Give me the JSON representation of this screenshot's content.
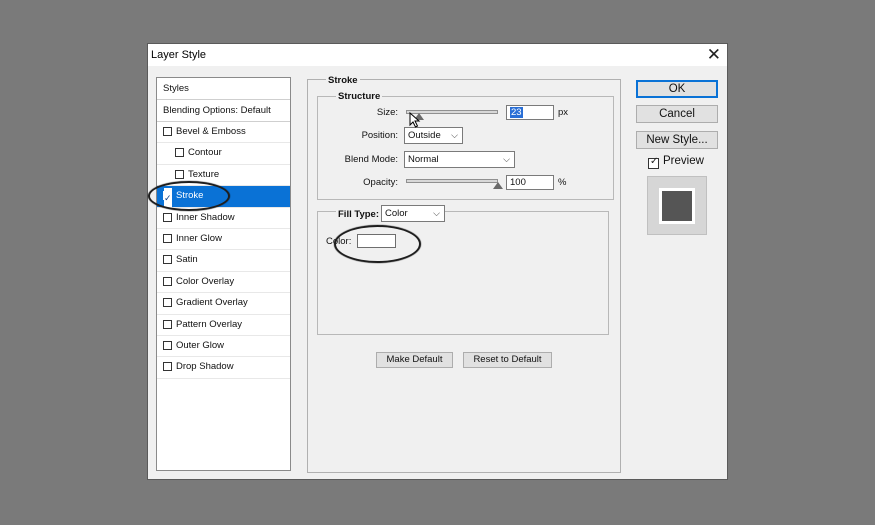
{
  "window": {
    "title": "Layer Style",
    "close_glyph": "✕"
  },
  "styles_panel": {
    "header": "Styles",
    "blending_options": "Blending Options: Default",
    "items": [
      {
        "label": "Bevel & Emboss",
        "checked": false,
        "indent": false
      },
      {
        "label": "Contour",
        "checked": false,
        "indent": true
      },
      {
        "label": "Texture",
        "checked": false,
        "indent": true
      },
      {
        "label": "Stroke",
        "checked": true,
        "selected": true,
        "indent": false
      },
      {
        "label": "Inner Shadow",
        "checked": false,
        "indent": false
      },
      {
        "label": "Inner Glow",
        "checked": false,
        "indent": false
      },
      {
        "label": "Satin",
        "checked": false,
        "indent": false
      },
      {
        "label": "Color Overlay",
        "checked": false,
        "indent": false
      },
      {
        "label": "Gradient Overlay",
        "checked": false,
        "indent": false
      },
      {
        "label": "Pattern Overlay",
        "checked": false,
        "indent": false
      },
      {
        "label": "Outer Glow",
        "checked": false,
        "indent": false
      },
      {
        "label": "Drop Shadow",
        "checked": false,
        "indent": false
      }
    ]
  },
  "stroke": {
    "section_title": "Stroke",
    "structure_title": "Structure",
    "size_label": "Size:",
    "size_value": "23",
    "size_unit": "px",
    "position_label": "Position:",
    "position_value": "Outside",
    "blend_mode_label": "Blend Mode:",
    "blend_mode_value": "Normal",
    "opacity_label": "Opacity:",
    "opacity_value": "100",
    "opacity_unit": "%",
    "fill_type_label": "Fill Type:",
    "fill_type_value": "Color",
    "color_label": "Color:",
    "color_value": "#ffffff",
    "make_default": "Make Default",
    "reset_default": "Reset to Default"
  },
  "buttons": {
    "ok": "OK",
    "cancel": "Cancel",
    "new_style": "New Style...",
    "preview_label": "Preview",
    "preview_checked": true
  },
  "icons": {
    "close": "close-icon",
    "caret": "chevron-down-icon",
    "check": "checkmark-icon",
    "pointer": "mouse-pointer-icon"
  },
  "colors": {
    "selection": "#0a72d6",
    "preview_fill": "#555555",
    "preview_stroke": "#ffffff"
  }
}
